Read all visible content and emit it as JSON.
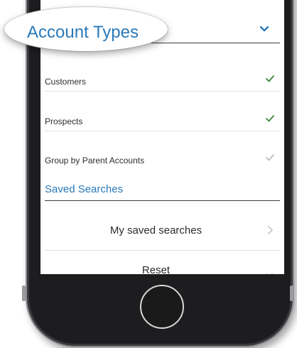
{
  "header": {
    "title": "Account Types"
  },
  "account_types": [
    {
      "label": "Customers",
      "checked": true,
      "check_color": "#3a8a3a"
    },
    {
      "label": "Prospects",
      "checked": true,
      "check_color": "#3a8a3a"
    },
    {
      "label": "Group by Parent Accounts",
      "checked": false,
      "check_color": "#bdbdbd"
    }
  ],
  "saved": {
    "section_title": "Saved Searches",
    "my_saved_label": "My saved searches"
  },
  "footer": {
    "reset_label": "Reset"
  },
  "colors": {
    "accent": "#2a7ab9",
    "check_active": "#3a8a3a",
    "check_inactive": "#bdbdbd"
  },
  "icons": [
    "chevron-down-icon",
    "checkmark-icon",
    "chevron-right-icon"
  ]
}
